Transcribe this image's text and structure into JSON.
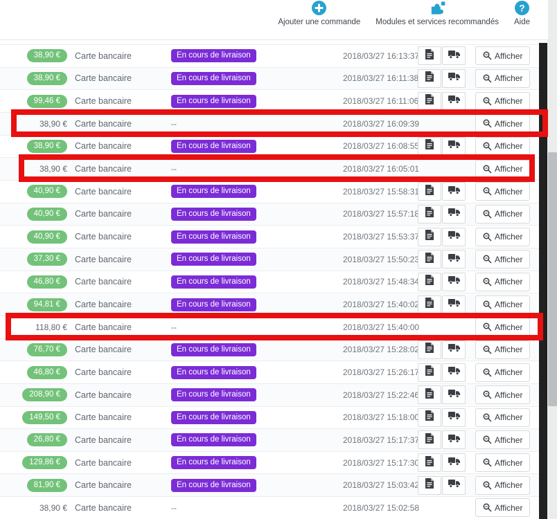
{
  "header": {
    "actions": [
      {
        "label": "Ajouter une commande",
        "icon": "plus-circle-icon"
      },
      {
        "label": "Modules et services recommandés",
        "icon": "puzzle-icon"
      },
      {
        "label": "Aide",
        "icon": "question-circle-icon"
      }
    ]
  },
  "colors": {
    "accent_blue": "#27a2cf",
    "badge_green": "#72c279",
    "badge_purple": "#7b2cd6",
    "annotation_red": "#e81010"
  },
  "table": {
    "action_label": "Afficher",
    "rows": [
      {
        "amount": "38,90 €",
        "payment": "Carte bancaire",
        "status": "En cours de livraison",
        "status_badge": true,
        "datetime": "2018/03/27 16:13:37",
        "has_docs": true,
        "highlighted": false
      },
      {
        "amount": "38,90 €",
        "payment": "Carte bancaire",
        "status": "En cours de livraison",
        "status_badge": true,
        "datetime": "2018/03/27 16:11:38",
        "has_docs": true,
        "highlighted": false
      },
      {
        "amount": "99,46 €",
        "payment": "Carte bancaire",
        "status": "En cours de livraison",
        "status_badge": true,
        "datetime": "2018/03/27 16:11:06",
        "has_docs": true,
        "highlighted": false
      },
      {
        "amount": "38,90 €",
        "payment": "Carte bancaire",
        "status": "--",
        "status_badge": false,
        "datetime": "2018/03/27 16:09:39",
        "has_docs": false,
        "highlighted": true
      },
      {
        "amount": "38,90 €",
        "payment": "Carte bancaire",
        "status": "En cours de livraison",
        "status_badge": true,
        "datetime": "2018/03/27 16:08:55",
        "has_docs": true,
        "highlighted": false
      },
      {
        "amount": "38,90 €",
        "payment": "Carte bancaire",
        "status": "--",
        "status_badge": false,
        "datetime": "2018/03/27 16:05:01",
        "has_docs": false,
        "highlighted": true
      },
      {
        "amount": "40,90 €",
        "payment": "Carte bancaire",
        "status": "En cours de livraison",
        "status_badge": true,
        "datetime": "2018/03/27 15:58:31",
        "has_docs": true,
        "highlighted": false
      },
      {
        "amount": "40,90 €",
        "payment": "Carte bancaire",
        "status": "En cours de livraison",
        "status_badge": true,
        "datetime": "2018/03/27 15:57:18",
        "has_docs": true,
        "highlighted": false
      },
      {
        "amount": "40,90 €",
        "payment": "Carte bancaire",
        "status": "En cours de livraison",
        "status_badge": true,
        "datetime": "2018/03/27 15:53:37",
        "has_docs": true,
        "highlighted": false
      },
      {
        "amount": "37,30 €",
        "payment": "Carte bancaire",
        "status": "En cours de livraison",
        "status_badge": true,
        "datetime": "2018/03/27 15:50:23",
        "has_docs": true,
        "highlighted": false
      },
      {
        "amount": "46,80 €",
        "payment": "Carte bancaire",
        "status": "En cours de livraison",
        "status_badge": true,
        "datetime": "2018/03/27 15:48:34",
        "has_docs": true,
        "highlighted": false
      },
      {
        "amount": "94,81 €",
        "payment": "Carte bancaire",
        "status": "En cours de livraison",
        "status_badge": true,
        "datetime": "2018/03/27 15:40:02",
        "has_docs": true,
        "highlighted": false
      },
      {
        "amount": "118,80 €",
        "payment": "Carte bancaire",
        "status": "--",
        "status_badge": false,
        "datetime": "2018/03/27 15:40:00",
        "has_docs": false,
        "highlighted": true
      },
      {
        "amount": "76,70 €",
        "payment": "Carte bancaire",
        "status": "En cours de livraison",
        "status_badge": true,
        "datetime": "2018/03/27 15:28:02",
        "has_docs": true,
        "highlighted": false
      },
      {
        "amount": "46,80 €",
        "payment": "Carte bancaire",
        "status": "En cours de livraison",
        "status_badge": true,
        "datetime": "2018/03/27 15:26:17",
        "has_docs": true,
        "highlighted": false
      },
      {
        "amount": "208,90 €",
        "payment": "Carte bancaire",
        "status": "En cours de livraison",
        "status_badge": true,
        "datetime": "2018/03/27 15:22:46",
        "has_docs": true,
        "highlighted": false
      },
      {
        "amount": "149,50 €",
        "payment": "Carte bancaire",
        "status": "En cours de livraison",
        "status_badge": true,
        "datetime": "2018/03/27 15:18:00",
        "has_docs": true,
        "highlighted": false
      },
      {
        "amount": "26,80 €",
        "payment": "Carte bancaire",
        "status": "En cours de livraison",
        "status_badge": true,
        "datetime": "2018/03/27 15:17:37",
        "has_docs": true,
        "highlighted": false
      },
      {
        "amount": "129,86 €",
        "payment": "Carte bancaire",
        "status": "En cours de livraison",
        "status_badge": true,
        "datetime": "2018/03/27 15:17:30",
        "has_docs": true,
        "highlighted": false
      },
      {
        "amount": "81,90 €",
        "payment": "Carte bancaire",
        "status": "En cours de livraison",
        "status_badge": true,
        "datetime": "2018/03/27 15:03:42",
        "has_docs": true,
        "highlighted": false
      },
      {
        "amount": "38,90 €",
        "payment": "Carte bancaire",
        "status": "--",
        "status_badge": false,
        "datetime": "2018/03/27 15:02:58",
        "has_docs": false,
        "highlighted": false
      }
    ]
  }
}
